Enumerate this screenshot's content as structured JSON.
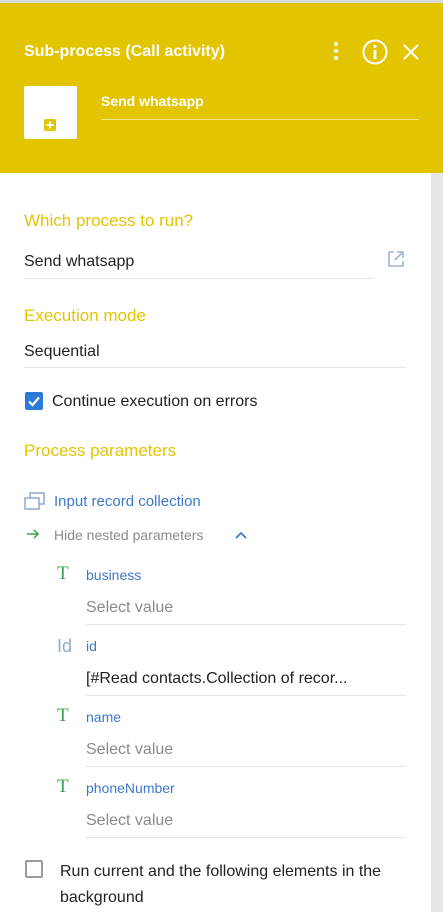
{
  "header": {
    "title": "Sub-process (Call activity)",
    "element_name": "Send whatsapp",
    "icons": [
      "more-vertical-icon",
      "info-icon",
      "close-icon",
      "add-icon"
    ],
    "accent_color": "#e3c400"
  },
  "process_to_run": {
    "label": "Which process to run?",
    "value": "Send whatsapp"
  },
  "execution_mode": {
    "label": "Execution mode",
    "value": "Sequential"
  },
  "continue_on_errors": {
    "label": "Continue execution on errors",
    "checked": true
  },
  "process_parameters": {
    "label": "Process parameters",
    "collection_link": "Input record collection",
    "nested_toggle": "Hide nested parameters",
    "params": [
      {
        "type_icon": "T",
        "name": "business",
        "value": "Select value"
      },
      {
        "type_icon": "Id",
        "name": "id",
        "value": "[#Read contacts.Collection of recor..."
      },
      {
        "type_icon": "T",
        "name": "name",
        "value": "Select value"
      },
      {
        "type_icon": "T",
        "name": "phoneNumber",
        "value": "Select value"
      }
    ]
  },
  "run_background": {
    "label": "Run current and the following elements in the background",
    "checked": false
  },
  "colors": {
    "section_label": "#e3c400",
    "link": "#3d78c8",
    "checkbox": "#2d7bd8",
    "text_type_icon": "#3aa34a"
  }
}
